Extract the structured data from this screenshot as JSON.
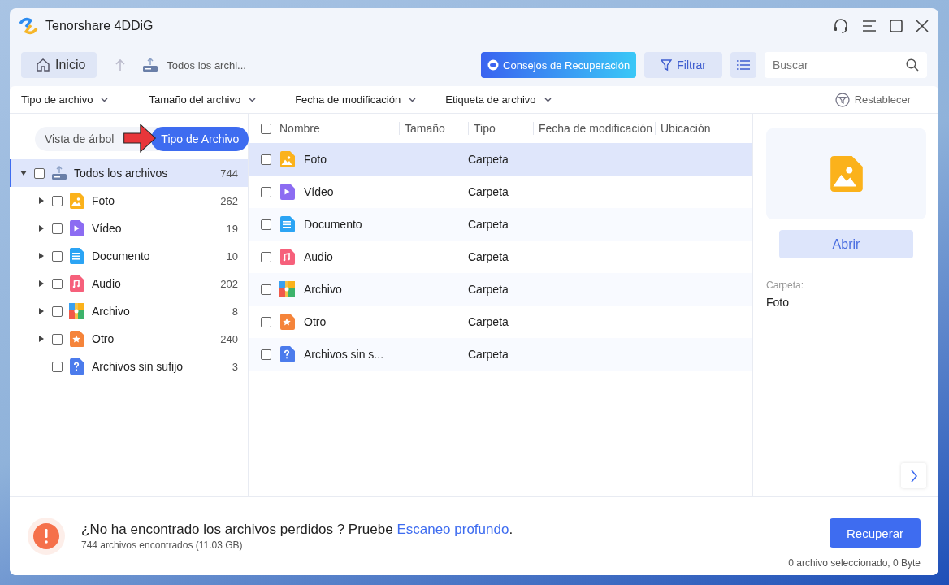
{
  "window": {
    "title": "Tenorshare 4DDiG"
  },
  "toolbar": {
    "home": "Inicio",
    "breadcrumb": "Todos los archi...",
    "tips_button": "Consejos de Recuperación",
    "filter_button": "Filtrar",
    "search": {
      "placeholder": "Buscar"
    }
  },
  "filters": {
    "dropdowns": [
      "Tipo de archivo",
      "Tamaño del archivo",
      "Fecha de modificación",
      "Etiqueta de archivo"
    ],
    "reset": "Restablecer"
  },
  "view_toggle": [
    {
      "label": "Vista de árbol",
      "selected": false
    },
    {
      "label": "Tipo de Archivo",
      "selected": true
    }
  ],
  "tree": {
    "label": "Todos los archivos",
    "count": "744",
    "expanded": true,
    "checked": false,
    "selected": true,
    "children": [
      {
        "label": "Foto",
        "count": "262",
        "kind": "photo",
        "expandable": true,
        "checked": false,
        "selected": false
      },
      {
        "label": "Vídeo",
        "count": "19",
        "kind": "video",
        "expandable": true,
        "checked": false,
        "selected": false
      },
      {
        "label": "Documento",
        "count": "10",
        "kind": "document",
        "expandable": true,
        "checked": false,
        "selected": false
      },
      {
        "label": "Audio",
        "count": "202",
        "kind": "audio",
        "expandable": true,
        "checked": false,
        "selected": false
      },
      {
        "label": "Archivo",
        "count": "8",
        "kind": "archive",
        "expandable": true,
        "checked": false,
        "selected": false
      },
      {
        "label": "Otro",
        "count": "240",
        "kind": "other",
        "expandable": true,
        "checked": false,
        "selected": false
      },
      {
        "label": "Archivos sin sufijo",
        "count": "3",
        "kind": "unknown",
        "expandable": false,
        "checked": false,
        "selected": false
      }
    ]
  },
  "table": {
    "all_checked": false,
    "columns": [
      "Nombre",
      "Tamaño",
      "Tipo",
      "Fecha de modificación",
      "Ubicación"
    ],
    "rows": [
      {
        "name": "Foto",
        "kind": "photo",
        "type": "Carpeta",
        "checked": false,
        "selected": true
      },
      {
        "name": "Vídeo",
        "kind": "video",
        "type": "Carpeta",
        "checked": false,
        "selected": false
      },
      {
        "name": "Documento",
        "kind": "document",
        "type": "Carpeta",
        "checked": false,
        "selected": false
      },
      {
        "name": "Audio",
        "kind": "audio",
        "type": "Carpeta",
        "checked": false,
        "selected": false
      },
      {
        "name": "Archivo",
        "kind": "archive",
        "type": "Carpeta",
        "checked": false,
        "selected": false
      },
      {
        "name": "Otro",
        "kind": "other",
        "type": "Carpeta",
        "checked": false,
        "selected": false
      },
      {
        "name": "Archivos sin s...",
        "kind": "unknown",
        "type": "Carpeta",
        "checked": false,
        "selected": false
      }
    ]
  },
  "preview": {
    "kind": "photo",
    "open_button": "Abrir",
    "label": "Carpeta:",
    "value": "Foto"
  },
  "footer": {
    "message": "¿No ha encontrado los archivos perdidos ? Pruebe ",
    "link": "Escaneo profundo",
    "message_end": ".",
    "summary": "744 archivos encontrados (11.03 GB)",
    "recover_button": "Recuperar",
    "selection": "0 archivo seleccionado, 0 Byte"
  }
}
